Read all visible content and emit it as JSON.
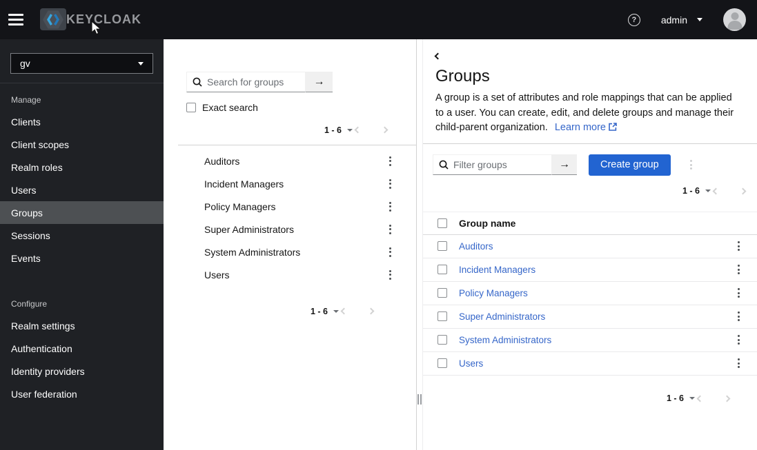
{
  "header": {
    "brand": "KEYCLOAK",
    "user": "admin"
  },
  "sidebar": {
    "realm": "gv",
    "manage_label": "Manage",
    "configure_label": "Configure",
    "manage_items": [
      "Clients",
      "Client scopes",
      "Realm roles",
      "Users",
      "Groups",
      "Sessions",
      "Events"
    ],
    "configure_items": [
      "Realm settings",
      "Authentication",
      "Identity providers",
      "User federation"
    ],
    "selected_item": "Groups"
  },
  "tree": {
    "search_placeholder": "Search for groups",
    "exact_label": "Exact search",
    "pagination": "1 - 6",
    "items": [
      "Auditors",
      "Incident Managers",
      "Policy Managers",
      "Super Administrators",
      "System Administrators",
      "Users"
    ]
  },
  "main": {
    "title": "Groups",
    "description": "A group is a set of attributes and role mappings that can be applied to a user. You can create, edit, and delete groups and manage their child-parent organization.",
    "learn_more": "Learn more",
    "filter_placeholder": "Filter groups",
    "create_button": "Create group",
    "pagination": "1 - 6",
    "table_header": "Group name",
    "rows": [
      "Auditors",
      "Incident Managers",
      "Policy Managers",
      "Super Administrators",
      "System Administrators",
      "Users"
    ]
  },
  "colors": {
    "primary": "#2264d1",
    "link": "#3566c9",
    "header_bg": "#131418",
    "sidebar_bg": "#1f2125",
    "sidebar_selected": "#4d5053"
  }
}
